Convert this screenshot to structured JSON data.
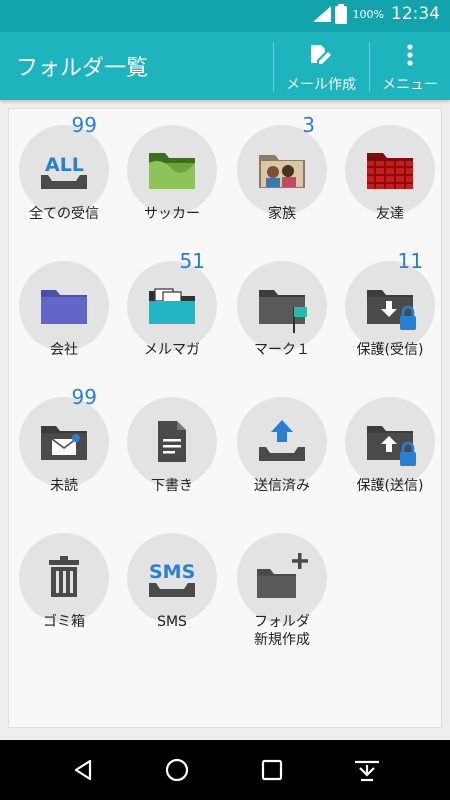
{
  "status_bar": {
    "battery_percent": "100%",
    "time": "12:34"
  },
  "app_bar": {
    "title": "フォルダ一覧",
    "compose_label": "メール作成",
    "menu_label": "メニュー"
  },
  "folders": [
    {
      "label": "全ての受信",
      "count": "99",
      "icon": "all-inbox-icon",
      "badge": "ALL"
    },
    {
      "label": "サッカー",
      "icon": "photo-folder-icon"
    },
    {
      "label": "家族",
      "count": "3",
      "icon": "photo-folder-icon"
    },
    {
      "label": "友達",
      "icon": "photo-folder-icon"
    },
    {
      "label": "会社",
      "icon": "folder-icon"
    },
    {
      "label": "メルマガ",
      "count": "51",
      "icon": "folder-with-mail-icon"
    },
    {
      "label": "マーク１",
      "icon": "flag-folder-icon"
    },
    {
      "label": "保護(受信)",
      "count": "11",
      "icon": "protected-inbox-icon"
    },
    {
      "label": "未読",
      "count": "99",
      "icon": "unread-mail-icon"
    },
    {
      "label": "下書き",
      "icon": "draft-document-icon"
    },
    {
      "label": "送信済み",
      "icon": "sent-upload-icon"
    },
    {
      "label": "保護(送信)",
      "icon": "protected-sent-icon"
    },
    {
      "label": "ゴミ箱",
      "icon": "trash-icon"
    },
    {
      "label": "SMS",
      "icon": "sms-icon",
      "badge": "SMS"
    },
    {
      "label": "フォルダ\n新規作成",
      "line1": "フォルダ",
      "line2": "新規作成",
      "icon": "add-folder-icon"
    }
  ],
  "nav_bar": {
    "buttons": [
      "back-icon",
      "home-icon",
      "recents-icon",
      "notification-down-icon"
    ]
  },
  "colors": {
    "primary": "#1db4bd",
    "status": "#13a3ac",
    "count": "#2b7fd0",
    "icon_gray": "#4a4a4a",
    "accent_blue": "#2b7fd0"
  }
}
